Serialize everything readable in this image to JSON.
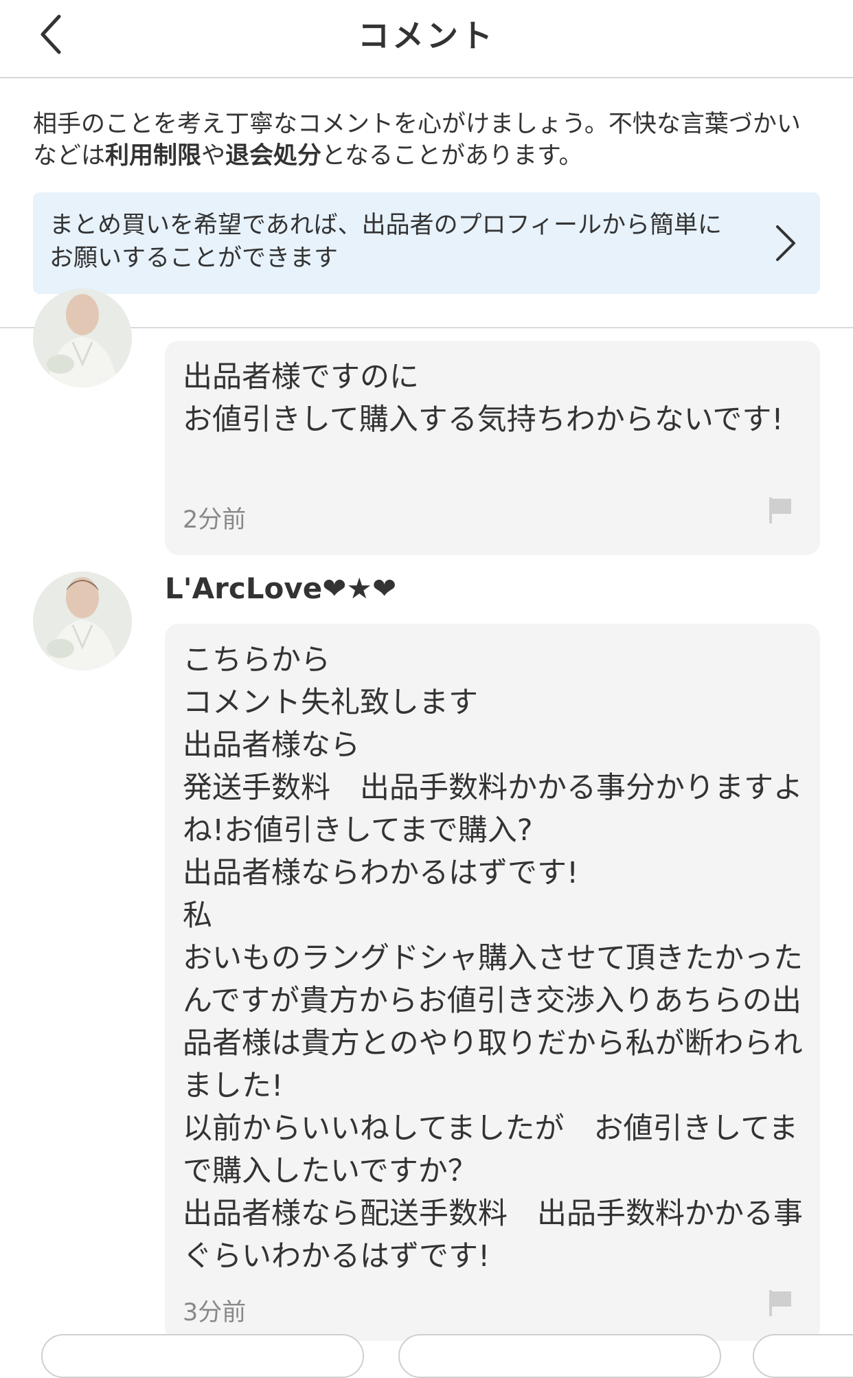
{
  "header": {
    "title": "コメント"
  },
  "notice": {
    "text_before": "相手のことを考え丁寧なコメントを心がけましょう。不快な言葉づかいなどは",
    "bold_1": "利用制限",
    "text_mid": "や",
    "bold_2": "退会処分",
    "text_after": "となることがあります。"
  },
  "banner": {
    "text": "まとめ買いを希望であれば、出品者のプロフィールから簡単にお願いすることができます"
  },
  "comments": [
    {
      "username": "",
      "text": "出品者様ですのに\nお値引きして購入する気持ちわからないです!",
      "time": "2分前"
    },
    {
      "username": "L'ArcLove❤★❤",
      "text": "こちらから\nコメント失礼致します\n出品者様なら\n発送手数料　出品手数料かかる事分かりますよね!お値引きしてまで購入?\n出品者様ならわかるはずです!\n私\nおいものラングドシャ購入させて頂きたかったんですが貴方からお値引き交渉入りあちらの出品者様は貴方とのやり取りだから私が断わられました!\n以前からいいねしてましたが　お値引きしてまで購入したいですか？\n出品者様なら配送手数料　出品手数料かかる事ぐらいわかるはずです!",
      "time": "3分前"
    }
  ],
  "icons": {
    "back": "chevron-left-icon",
    "banner_arrow": "chevron-right-icon",
    "report": "flag-icon"
  },
  "colors": {
    "banner_bg": "#e7f2fb",
    "bubble_bg": "#f4f4f4",
    "text": "#333333",
    "muted": "#888888"
  }
}
